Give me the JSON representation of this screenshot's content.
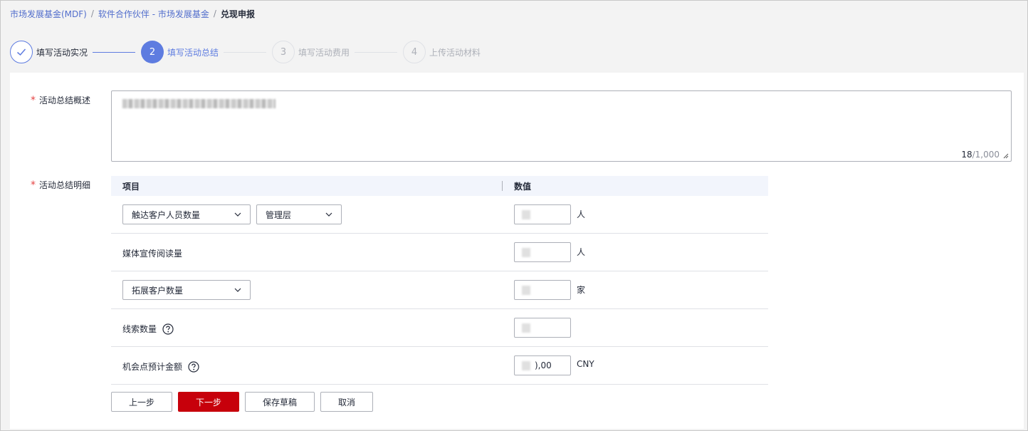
{
  "breadcrumb": {
    "items": [
      "市场发展基金(MDF)",
      "软件合作伙伴 - 市场发展基金"
    ],
    "separator": "/",
    "current": "兑现申报"
  },
  "steps": [
    {
      "number": "",
      "label": "填写活动实况",
      "state": "done"
    },
    {
      "number": "2",
      "label": "填写活动总结",
      "state": "active"
    },
    {
      "number": "3",
      "label": "填写活动费用",
      "state": "todo"
    },
    {
      "number": "4",
      "label": "上传活动材料",
      "state": "todo"
    }
  ],
  "form": {
    "summary_label": "活动总结概述",
    "summary_count": "18",
    "summary_max": "/1,000",
    "detail_label": "活动总结明细",
    "required_mark": "*"
  },
  "table": {
    "headers": {
      "item": "项目",
      "value": "数值"
    },
    "rows": [
      {
        "select1": "触达客户人员数量",
        "select2": "管理层",
        "unit": "人"
      },
      {
        "label": "媒体宣传阅读量",
        "unit": "人"
      },
      {
        "select1": "拓展客户数量",
        "unit": "家"
      },
      {
        "label": "线索数量",
        "unit": ""
      },
      {
        "label": "机会点预计金额",
        "value_suffix": "),00",
        "unit": "CNY"
      }
    ]
  },
  "buttons": {
    "prev": "上一步",
    "next": "下一步",
    "save_draft": "保存草稿",
    "cancel": "取消"
  },
  "colors": {
    "accent": "#5e7ce0",
    "primary_button": "#c7000b",
    "required": "#e54545",
    "link": "#526ecc"
  }
}
